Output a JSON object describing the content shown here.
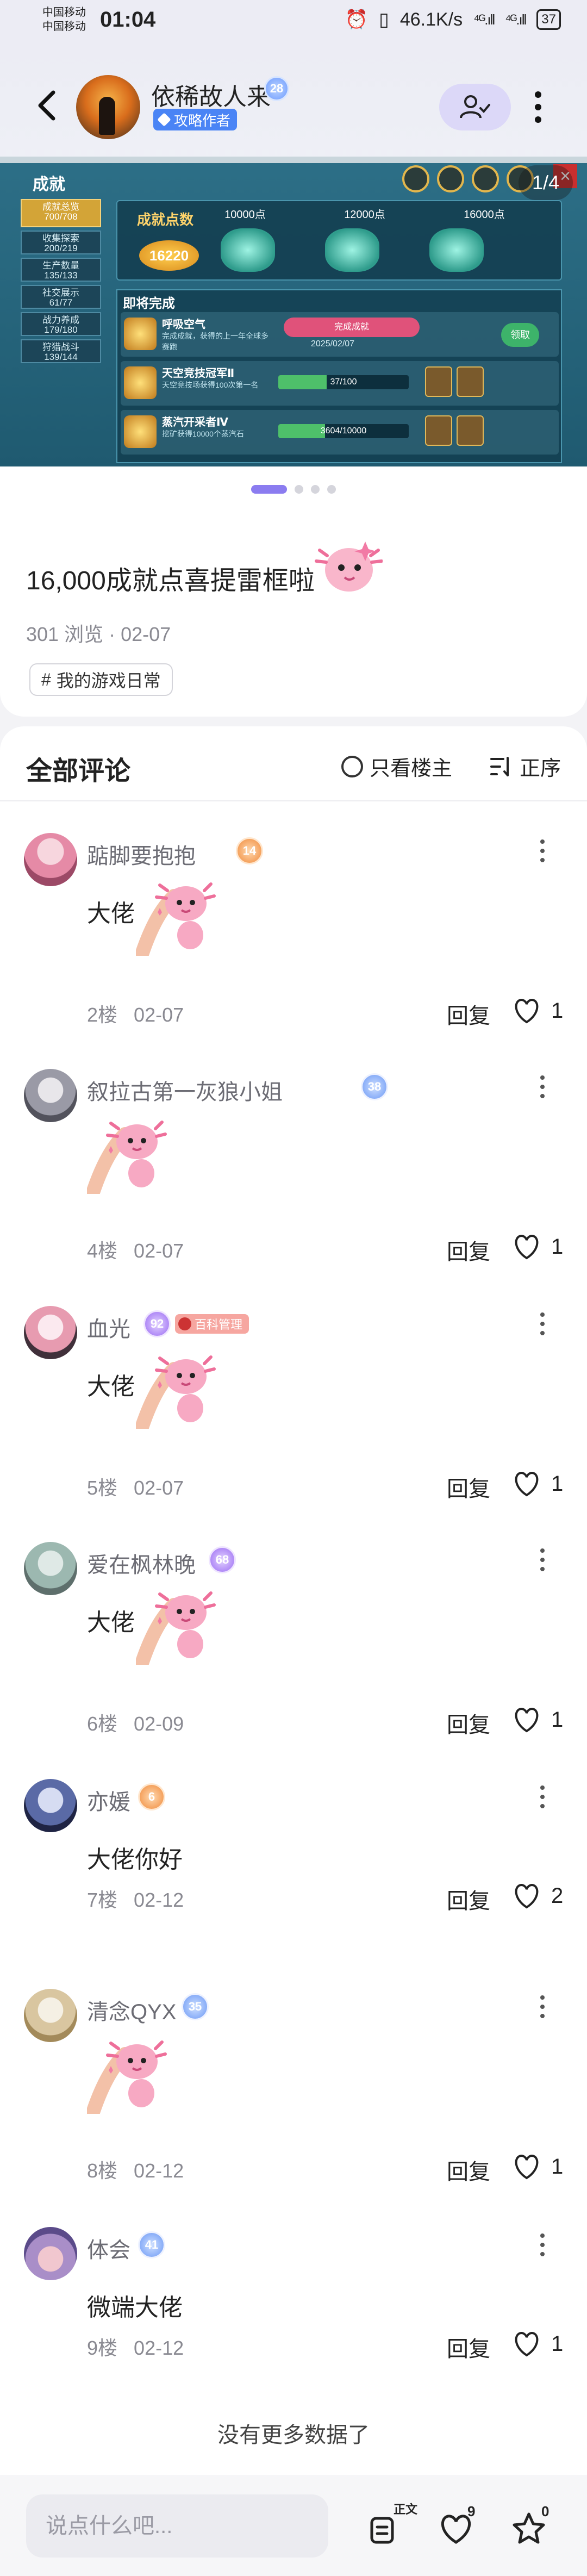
{
  "status_bar": {
    "carrier_1": "中国移动",
    "carrier_2": "中国移动",
    "time": "01:04",
    "net_speed": "46.1K/s",
    "signal_1": "⁴ᴳ.ıll",
    "signal_2": "⁴ᴳ.ıll",
    "battery": "37"
  },
  "header": {
    "author_name": "依稀故人来",
    "author_level": "28",
    "author_tag": "攻略作者"
  },
  "media": {
    "page_counter": "1/4",
    "dots_total": 4,
    "dots_active": 1,
    "game": {
      "title": "成就",
      "sidebar": [
        "成就总览\n700/708",
        "收集探索\n200/219",
        "生产数量\n135/133",
        "社交展示\n61/77",
        "战力养成\n179/180",
        "狩猎战斗\n139/144"
      ],
      "points_label": "成就点数",
      "points_value": "16220",
      "milestones": [
        "10000点",
        "12000点",
        "16000点"
      ],
      "list_title": "即将完成",
      "rows": [
        {
          "name": "呼吸空气",
          "desc": "完成成就，获得的上一年全球多赛跑",
          "done": "完成成就",
          "date": "2025/02/07",
          "claim": "领取"
        },
        {
          "name": "天空竞技冠军Ⅱ",
          "desc": "天空竞技场获得100次第一名",
          "progress": "37/100",
          "fill": 0.37
        },
        {
          "name": "蒸汽开采者Ⅳ",
          "desc": "挖矿获得10000个蒸汽石",
          "progress": "3604/10000",
          "fill": 0.36
        }
      ]
    }
  },
  "post": {
    "title": "16,000成就点喜提雷框啦",
    "views": "301 浏览",
    "date": "02-07",
    "topic": "我的游戏日常"
  },
  "comments_section": {
    "title": "全部评论",
    "filter_host_only": "只看楼主",
    "sort_label": "正序",
    "reply_label": "回复",
    "no_more": "没有更多数据了",
    "items": [
      {
        "name": "踮脚要抱抱",
        "level": "14",
        "text": "大佬",
        "floor": "2楼",
        "date": "02-07",
        "likes": "1"
      },
      {
        "name": "叙拉古第一灰狼小姐",
        "level": "38",
        "text": "",
        "floor": "4楼",
        "date": "02-07",
        "likes": "1"
      },
      {
        "name": "血光",
        "level": "92",
        "role": "百科管理",
        "text": "大佬",
        "floor": "5楼",
        "date": "02-07",
        "likes": "1"
      },
      {
        "name": "爱在枫林晚",
        "level": "68",
        "text": "大佬",
        "floor": "6楼",
        "date": "02-09",
        "likes": "1"
      },
      {
        "name": "亦媛",
        "level": "6",
        "text": "大佬你好",
        "floor": "7楼",
        "date": "02-12",
        "likes": "2"
      },
      {
        "name": "清念QYX",
        "level": "35",
        "text": "",
        "floor": "8楼",
        "date": "02-12",
        "likes": "1"
      },
      {
        "name": "体会",
        "level": "41",
        "text": "微端大佬",
        "floor": "9楼",
        "date": "02-12",
        "likes": "1"
      }
    ]
  },
  "bottom_bar": {
    "input_placeholder": "说点什么吧...",
    "doc_badge": "正文",
    "like_count": "9",
    "fav_count": "0"
  },
  "colors": {
    "accent": "#8b7cf0",
    "tag_blue": "#4a84f5",
    "follow_bg": "#dcd8f8"
  }
}
